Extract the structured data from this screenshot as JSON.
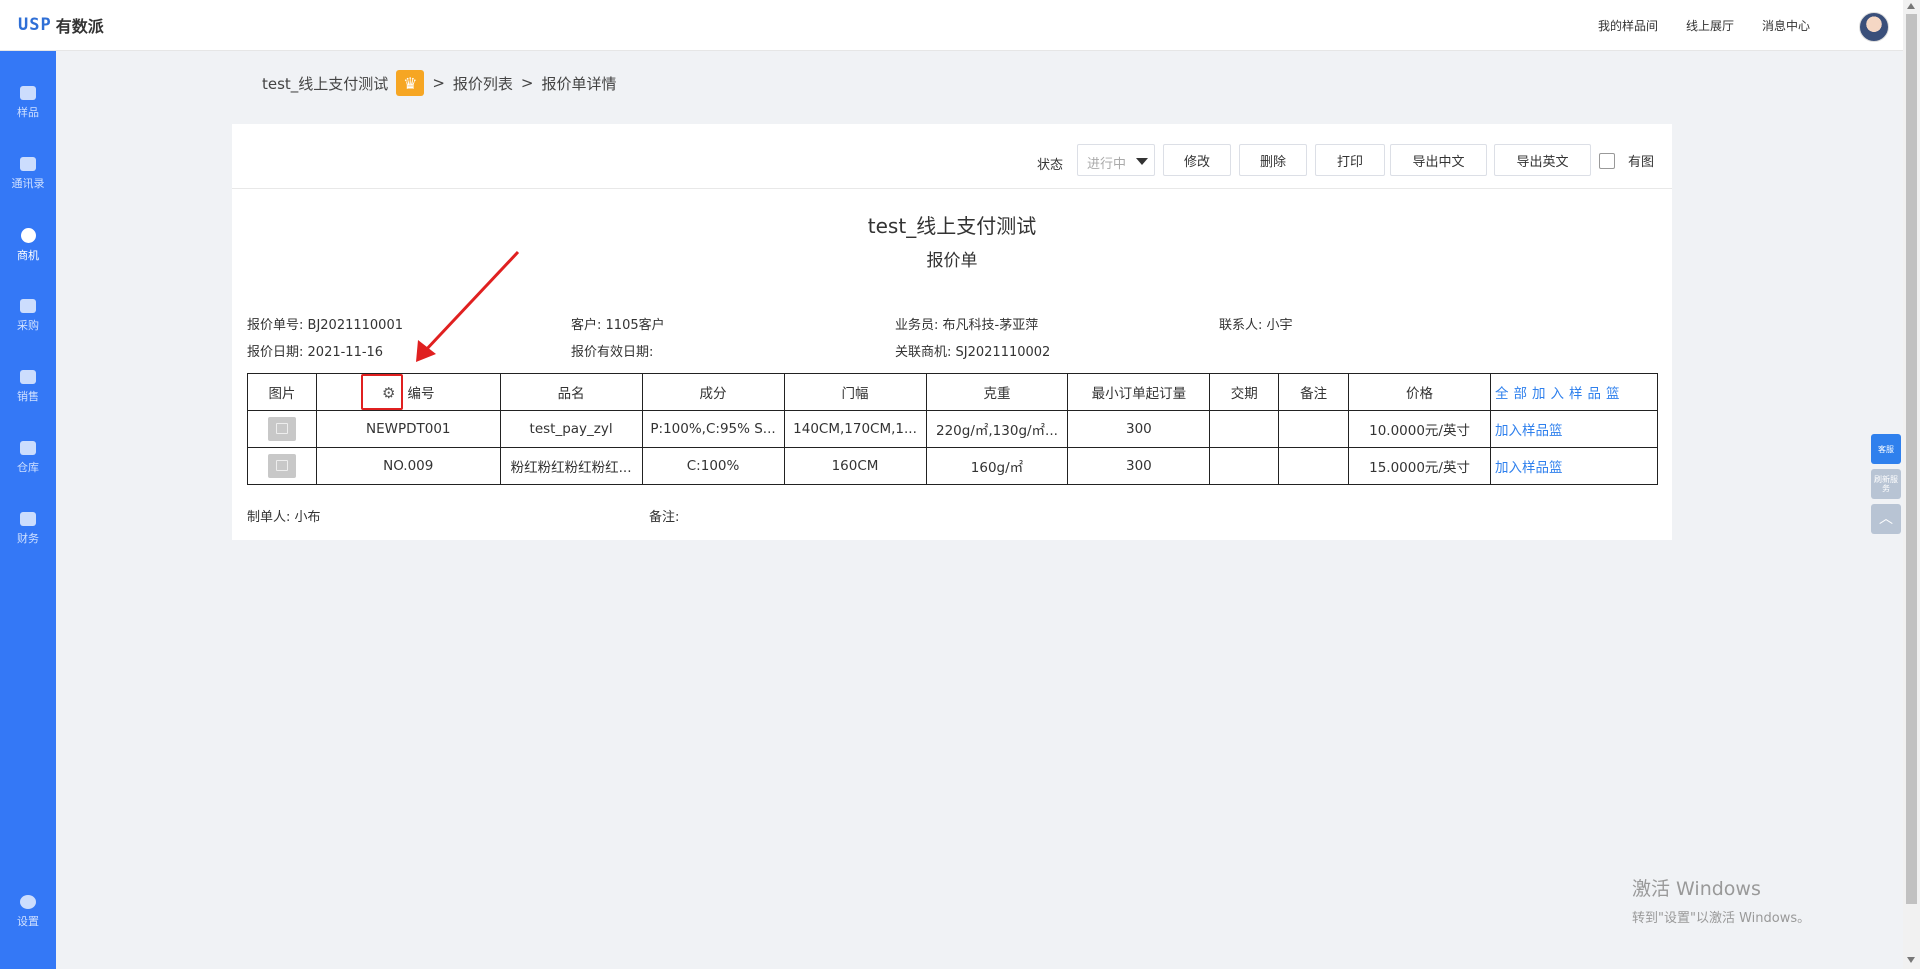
{
  "header": {
    "logo_mark": "USP",
    "logo_text": "有数派",
    "nav": [
      "我的样品间",
      "线上展厅",
      "消息中心"
    ]
  },
  "sidebar": {
    "items": [
      {
        "label": "样品",
        "icon": "sample-icon"
      },
      {
        "label": "通讯录",
        "icon": "contacts-icon"
      },
      {
        "label": "商机",
        "icon": "opportunity-icon",
        "active": true
      },
      {
        "label": "采购",
        "icon": "purchase-icon"
      },
      {
        "label": "销售",
        "icon": "sales-icon"
      },
      {
        "label": "仓库",
        "icon": "warehouse-icon"
      },
      {
        "label": "财务",
        "icon": "finance-icon"
      },
      {
        "label": "设置",
        "icon": "settings-icon"
      }
    ]
  },
  "breadcrumb": {
    "company": "test_线上支付测试",
    "sep1": ">",
    "list": "报价列表",
    "sep2": ">",
    "current": "报价单详情"
  },
  "toolbar": {
    "status_label": "状态",
    "status_value": "进行中",
    "buttons": [
      "修改",
      "删除",
      "打印",
      "导出中文",
      "导出英文"
    ],
    "with_image_label": "有图"
  },
  "document": {
    "title": "test_线上支付测试",
    "subtitle": "报价单",
    "quote_no_label": "报价单号:",
    "quote_no": "BJ2021110001",
    "customer_label": "客户:",
    "customer": "1105客户",
    "salesman_label": "业务员:",
    "salesman": "布凡科技-茅亚萍",
    "contact_label": "联系人:",
    "contact": "小宇",
    "quote_date_label": "报价日期:",
    "quote_date": "2021-11-16",
    "valid_date_label": "报价有效日期:",
    "valid_date": "",
    "related_label": "关联商机:",
    "related": "SJ2021110002"
  },
  "table": {
    "headers": [
      "图片",
      "编号",
      "品名",
      "成分",
      "门幅",
      "克重",
      "最小订单起订量",
      "交期",
      "备注",
      "价格",
      "全 部 加 入 样 品 篮"
    ],
    "add_all_main": "全部加入样品",
    "add_all_last": "篮",
    "rows": [
      {
        "code": "NEWPDT001",
        "name": "test_pay_zyl",
        "composition": "P:100%,C:95% S...",
        "width": "140CM,170CM,1...",
        "weight": "220g/㎡,130g/㎡...",
        "moq": "300",
        "delivery": "",
        "remark": "",
        "price": "10.0000元/英寸",
        "action": "加入样品篮"
      },
      {
        "code": "NO.009",
        "name": "粉红粉红粉红粉红...",
        "composition": "C:100%",
        "width": "160CM",
        "weight": "160g/㎡",
        "moq": "300",
        "delivery": "",
        "remark": "",
        "price": "15.0000元/英寸",
        "action": "加入样品篮"
      }
    ]
  },
  "footer": {
    "creator_label": "制单人:",
    "creator": "小布",
    "remark_label": "备注:",
    "remark": ""
  },
  "float_buttons": [
    "客服",
    "刷新服务"
  ],
  "watermark": {
    "line1": "激活 Windows",
    "line2": "转到\"设置\"以激活 Windows。"
  },
  "colors": {
    "sidebar": "#3478f6",
    "link": "#2f80ed",
    "crown": "#f6a623",
    "annotation": "#e02020"
  }
}
